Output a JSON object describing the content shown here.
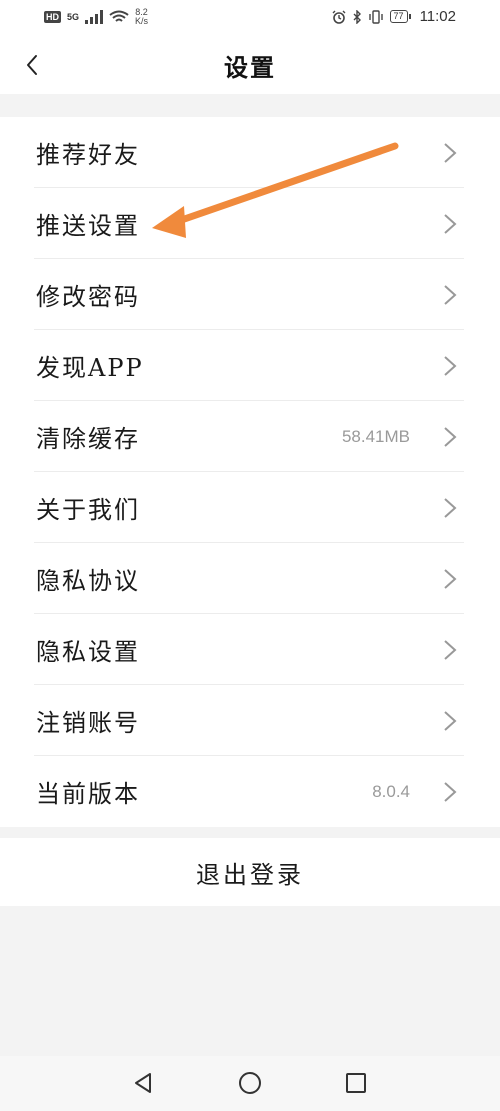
{
  "status_bar": {
    "hd_badge": "HD",
    "network": "5G",
    "speed_value": "8.2",
    "speed_unit": "K/s",
    "battery": "77",
    "time": "11:02"
  },
  "header": {
    "title": "设置"
  },
  "menu": {
    "items": [
      {
        "label": "推荐好友",
        "value": ""
      },
      {
        "label": "推送设置",
        "value": ""
      },
      {
        "label": "修改密码",
        "value": ""
      },
      {
        "label": "发现APP",
        "value": ""
      },
      {
        "label": "清除缓存",
        "value": "58.41MB"
      },
      {
        "label": "关于我们",
        "value": ""
      },
      {
        "label": "隐私协议",
        "value": ""
      },
      {
        "label": "隐私设置",
        "value": ""
      },
      {
        "label": "注销账号",
        "value": ""
      },
      {
        "label": "当前版本",
        "value": "8.0.4"
      }
    ]
  },
  "logout": {
    "label": "退出登录"
  },
  "annotation": {
    "arrow_color": "#f08a3c"
  },
  "icons": {
    "back": "chevron-left-icon",
    "item": "chevron-right-icon",
    "nav_back": "triangle-back-icon",
    "nav_home": "circle-home-icon",
    "nav_recent": "square-recent-icon"
  }
}
